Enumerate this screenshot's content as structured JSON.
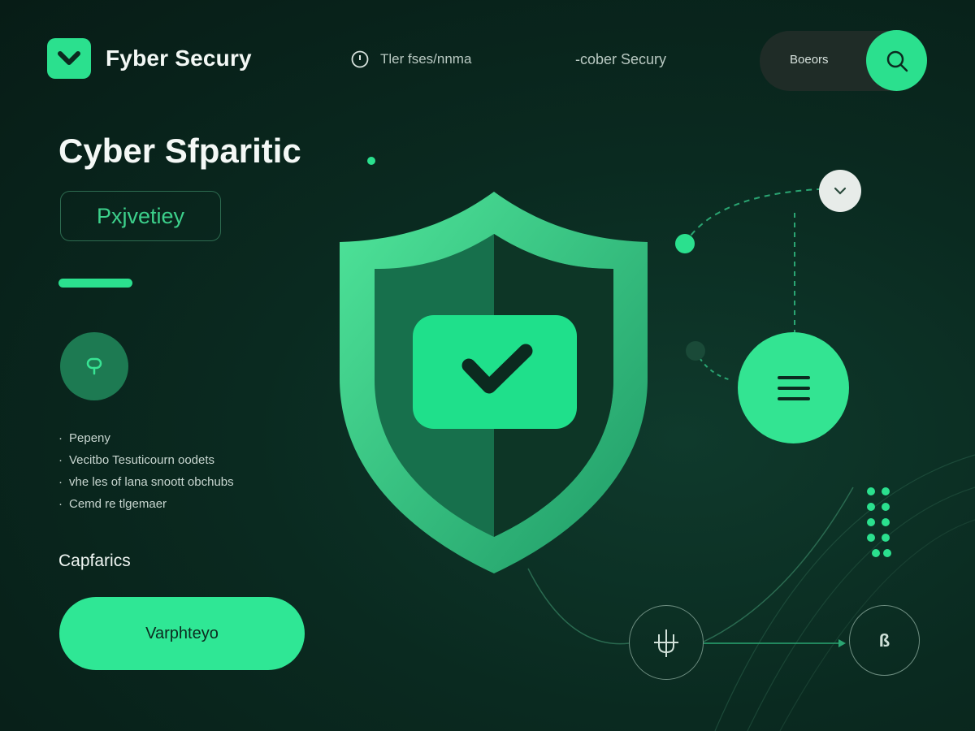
{
  "header": {
    "brand": "Fyber Secury",
    "nav_item_1": "Tler fses/nnma",
    "nav_item_2": "-cober Secury",
    "search_label": "Boeors"
  },
  "hero": {
    "title": "Cyber Sfparitic",
    "outline_button": "Pxjvetiey",
    "features": [
      "Pepeny",
      "Vecitbo Tesuticourn oodets",
      "vhe les of lana snoott obchubs",
      "Cemd re tlgemaer"
    ],
    "section_label": "Capfarics",
    "cta_label": "Varphteyo"
  },
  "nodes": {
    "bottom_right_label": "ß"
  },
  "colors": {
    "accent": "#2be08e",
    "background": "#0a2a20",
    "dark_green": "#1d7a52"
  },
  "icons": {
    "logo": "chevron-check-icon",
    "nav": "clock-icon",
    "search": "search-icon",
    "feature": "key-icon",
    "shield": "shield-check-icon",
    "menu": "hamburger-menu-icon",
    "top_node": "chevron-down-icon",
    "bottom_node": "plug-icon"
  }
}
